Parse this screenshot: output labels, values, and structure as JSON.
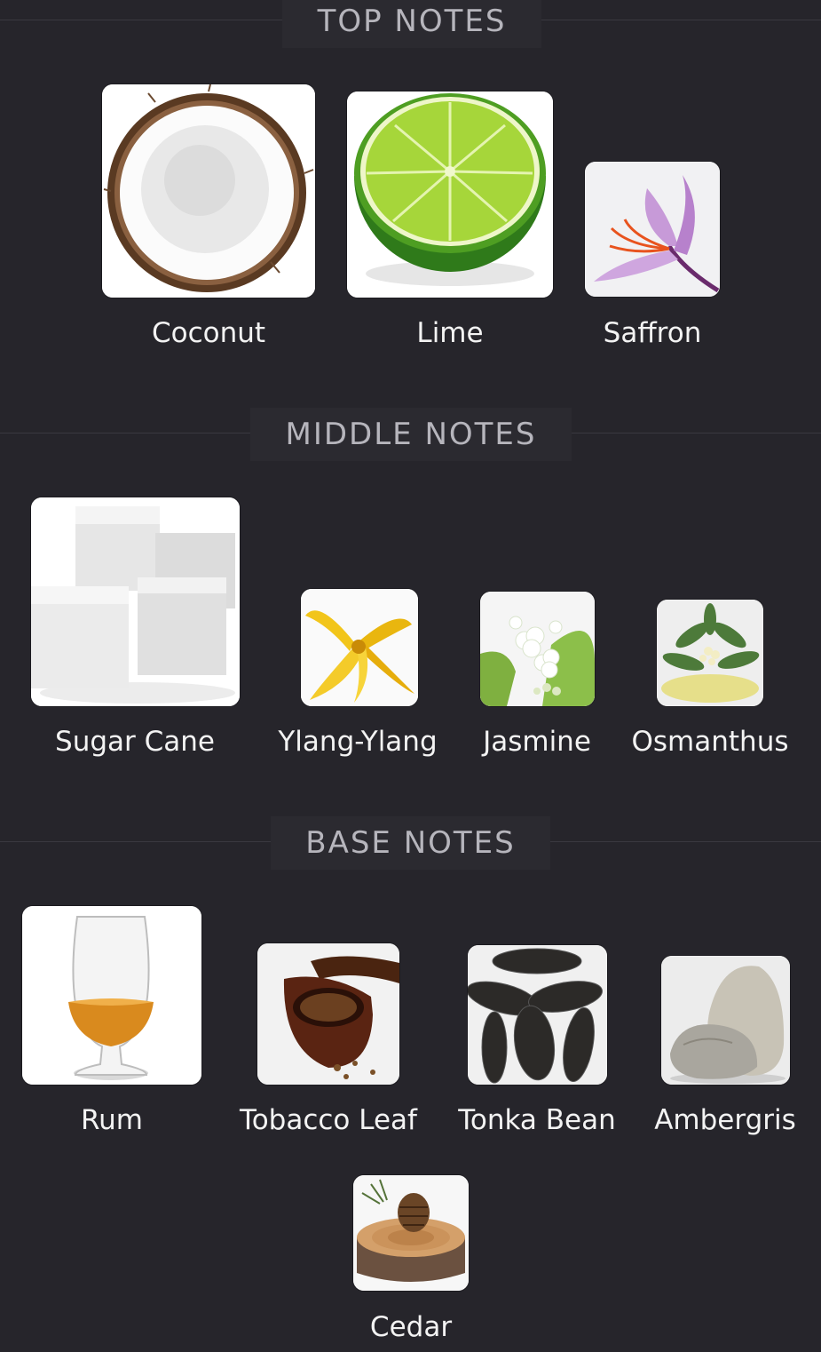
{
  "sections": {
    "top": {
      "title": "TOP NOTES",
      "items": [
        {
          "label": "Coconut",
          "icon": "coconut-icon"
        },
        {
          "label": "Lime",
          "icon": "lime-icon"
        },
        {
          "label": "Saffron",
          "icon": "saffron-icon"
        }
      ]
    },
    "middle": {
      "title": "MIDDLE NOTES",
      "items": [
        {
          "label": "Sugar Cane",
          "icon": "sugar-cube-icon"
        },
        {
          "label": "Ylang-Ylang",
          "icon": "ylang-ylang-icon"
        },
        {
          "label": "Jasmine",
          "icon": "jasmine-icon"
        },
        {
          "label": "Osmanthus",
          "icon": "osmanthus-icon"
        }
      ]
    },
    "base": {
      "title": "BASE NOTES",
      "items": [
        {
          "label": "Rum",
          "icon": "rum-glass-icon"
        },
        {
          "label": "Tobacco Leaf",
          "icon": "tobacco-pipe-icon"
        },
        {
          "label": "Tonka Bean",
          "icon": "tonka-bean-icon"
        },
        {
          "label": "Ambergris",
          "icon": "ambergris-icon"
        },
        {
          "label": "Cedar",
          "icon": "cedar-icon"
        }
      ]
    }
  }
}
